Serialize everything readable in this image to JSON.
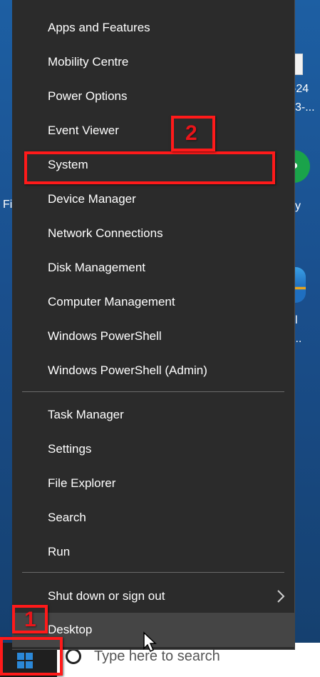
{
  "desktop": {
    "fragments": {
      "date_a": "-24",
      "date_b": "3-...",
      "label_fi": "Fi",
      "label_y": "y",
      "label_l": "l",
      "ellipsis": "..."
    }
  },
  "menu": {
    "group1": [
      {
        "label": "Apps and Features"
      },
      {
        "label": "Mobility Centre"
      },
      {
        "label": "Power Options"
      },
      {
        "label": "Event Viewer"
      },
      {
        "label": "System"
      },
      {
        "label": "Device Manager"
      },
      {
        "label": "Network Connections"
      },
      {
        "label": "Disk Management"
      },
      {
        "label": "Computer Management"
      },
      {
        "label": "Windows PowerShell"
      },
      {
        "label": "Windows PowerShell (Admin)"
      }
    ],
    "group2": [
      {
        "label": "Task Manager"
      },
      {
        "label": "Settings"
      },
      {
        "label": "File Explorer"
      },
      {
        "label": "Search"
      },
      {
        "label": "Run"
      }
    ],
    "group3": [
      {
        "label": "Shut down or sign out",
        "has_submenu": true
      },
      {
        "label": "Desktop",
        "highlighted": true
      }
    ]
  },
  "taskbar": {
    "search_placeholder": "Type here to search"
  },
  "annotations": {
    "step1": "1",
    "step2": "2",
    "color": "#ff1a1a"
  },
  "colors": {
    "menu_bg": "#2b2b2b",
    "menu_hover": "#454545",
    "menu_text": "#ffffff",
    "windows_blue": "#2b88d8"
  }
}
